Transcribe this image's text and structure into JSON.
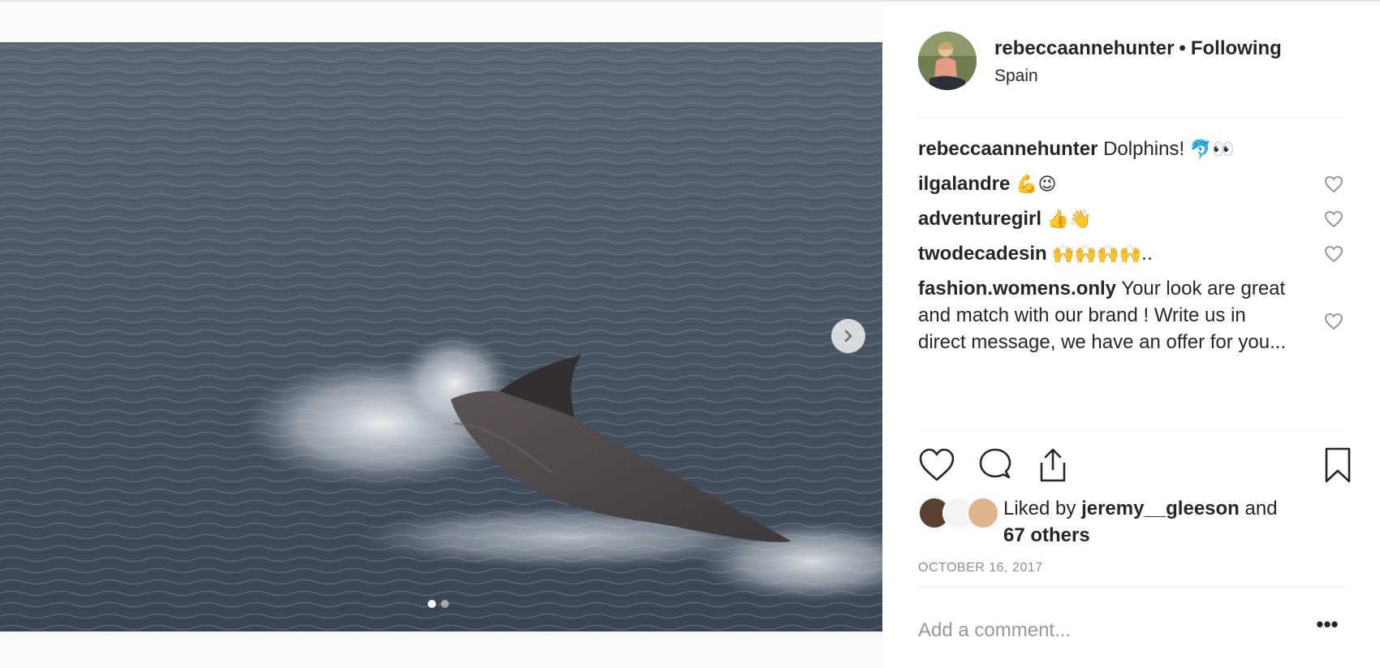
{
  "post": {
    "username": "rebeccaannehunter",
    "separator": "•",
    "follow_status": "Following",
    "location": "Spain",
    "photo_alt": "dolphin",
    "carousel": {
      "total": 2,
      "current": 1
    }
  },
  "caption": {
    "username": "rebeccaannehunter",
    "text": "Dolphins!",
    "emoji": "🐬👀"
  },
  "comments": [
    {
      "username": "ilgalandre",
      "text": "",
      "emoji": "💪😉"
    },
    {
      "username": "adventuregirl",
      "text": "",
      "emoji": "👍👋"
    },
    {
      "username": "twodecadesin",
      "text": "",
      "emoji": "🙌🙌🙌🙌..",
      "text_suffix": ""
    },
    {
      "username": "fashion.womens.only",
      "text": "Your look are great and match with our brand ! Write us in direct message, we have an offer for you...",
      "emoji": ""
    }
  ],
  "likes": {
    "prefix": "Liked by",
    "user": "jeremy__gleeson",
    "connector": "and",
    "others": "67 others"
  },
  "date": "OCTOBER 16, 2017",
  "comment_box": {
    "placeholder": "Add a comment..."
  },
  "more_label": "•••",
  "icons": {
    "like": "heart-icon",
    "comment": "comment-bubble-icon",
    "share": "share-icon",
    "save": "bookmark-icon",
    "next": "chevron-right-icon"
  },
  "colors": {
    "text": "#262626",
    "muted": "#8e8e8e",
    "divider": "#efefef",
    "water": "#4a5564"
  }
}
